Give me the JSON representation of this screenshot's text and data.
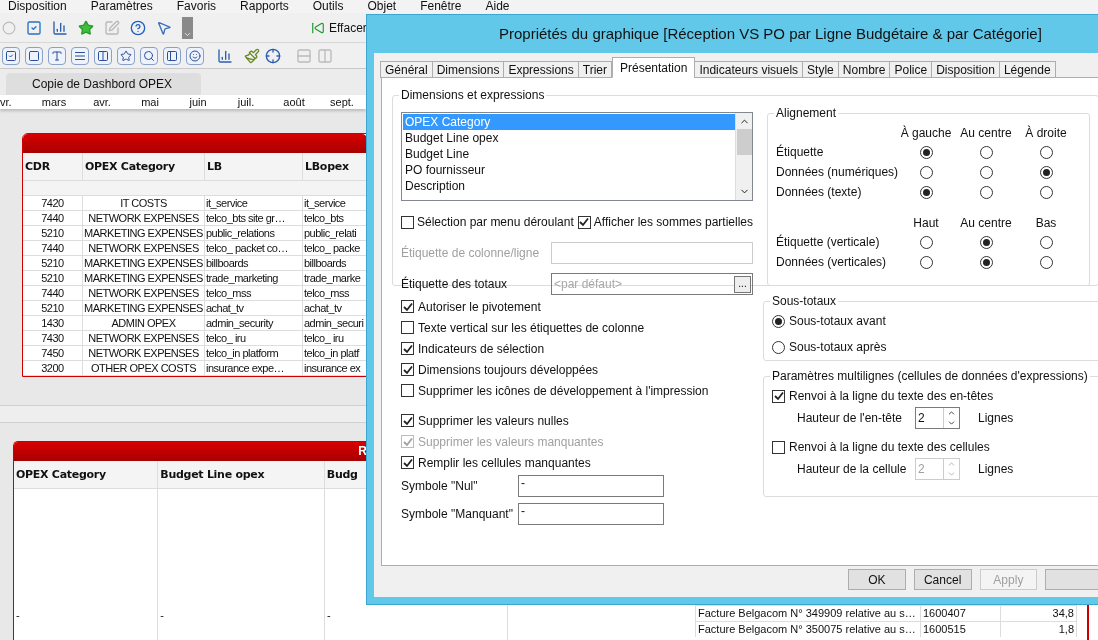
{
  "menu_bar": [
    "Disposition",
    "Paramètres",
    "Favoris",
    "Rapports",
    "Outils",
    "Objet",
    "Fenêtre",
    "Aide"
  ],
  "toolbar": {
    "clear_button": "Effacer"
  },
  "document_tab": "Copie de Dashbord OPEX",
  "timeline": [
    "vr.",
    "mars",
    "avr.",
    "mai",
    "juin",
    "juil.",
    "août",
    "sept."
  ],
  "table_1": {
    "columns": [
      "CDR",
      "OPEX Category",
      "LB",
      "LBopex"
    ],
    "rows": [
      [
        "7420",
        "IT COSTS",
        "it_service",
        "it_service"
      ],
      [
        "7440",
        "NETWORK EXPENSES",
        "telco_bts site gr…",
        "telco_bts"
      ],
      [
        "5210",
        "MARKETING EXPENSES",
        "public_relations",
        "public_relati"
      ],
      [
        "7440",
        "NETWORK EXPENSES",
        "telco_ packet co…",
        "telco_ packe"
      ],
      [
        "5210",
        "MARKETING EXPENSES",
        "billboards",
        "billboards"
      ],
      [
        "5210",
        "MARKETING EXPENSES",
        "trade_marketing",
        "trade_marke"
      ],
      [
        "7440",
        "NETWORK EXPENSES",
        "telco_mss",
        "telco_mss"
      ],
      [
        "5210",
        "MARKETING EXPENSES",
        "achat_tv",
        "achat_tv"
      ],
      [
        "1430",
        "ADMIN OPEX",
        "admin_security",
        "admin_securi"
      ],
      [
        "7430",
        "NETWORK EXPENSES",
        "telco_ iru",
        "telco_ iru"
      ],
      [
        "7450",
        "NETWORK EXPENSES",
        "telco_in platform",
        "telco_in platf"
      ],
      [
        "3200",
        "OTHER OPEX COSTS",
        "insurance expe…",
        "insurance ex"
      ]
    ]
  },
  "table_2": {
    "title": "R",
    "columns": [
      "OPEX Category",
      "Budget Line opex",
      "Budg"
    ],
    "rows": [
      [
        "-",
        "-",
        "-"
      ]
    ]
  },
  "table_3": {
    "rows": [
      [
        "Facture Belgacom N° 349909 relative au s…",
        "1600407",
        "34,8"
      ],
      [
        "Facture Belgacom N° 350075 relative au s…",
        "1600515",
        "1,8"
      ]
    ]
  },
  "dialog": {
    "title": "Propriétés du graphique [Réception VS PO par Ligne Budgétaire & par Catégorie]",
    "tabs": [
      {
        "label": "Général",
        "selected": false
      },
      {
        "label": "Dimensions",
        "selected": false
      },
      {
        "label": "Expressions",
        "selected": false
      },
      {
        "label": "Trier",
        "selected": false
      },
      {
        "label": "Présentation",
        "selected": true
      },
      {
        "label": "Indicateurs visuels",
        "selected": false
      },
      {
        "label": "Style",
        "selected": false
      },
      {
        "label": "Nombre",
        "selected": false
      },
      {
        "label": "Police",
        "selected": false
      },
      {
        "label": "Disposition",
        "selected": false
      },
      {
        "label": "Légende",
        "selected": false
      }
    ],
    "dimensions_group": {
      "label": "Dimensions et expressions",
      "list": [
        {
          "label": "OPEX Category",
          "selected": true
        },
        {
          "label": "Budget Line opex",
          "selected": false
        },
        {
          "label": "Budget Line",
          "selected": false
        },
        {
          "label": "PO fournisseur",
          "selected": false
        },
        {
          "label": "Description",
          "selected": false
        }
      ],
      "dropdown_select": {
        "label": "Sélection par menu déroulant",
        "checked": false
      },
      "partial_sums": {
        "label": "Afficher les sommes partielles",
        "checked": true
      },
      "column_label": {
        "label": "Étiquette de colonne/ligne",
        "disabled": true
      },
      "totals_label": {
        "label": "Étiquette des totaux",
        "placeholder": "<par défaut>",
        "button": "..."
      }
    },
    "alignment": {
      "label": "Alignement",
      "columns": [
        "À gauche",
        "Au centre",
        "À droite"
      ],
      "rows": [
        {
          "label": "Étiquette",
          "options": [
            {
              "selected": true
            },
            {
              "selected": false
            },
            {
              "selected": false
            }
          ]
        },
        {
          "label": "Données (numériques)",
          "options": [
            {
              "selected": false
            },
            {
              "selected": false
            },
            {
              "selected": true
            }
          ]
        },
        {
          "label": "Données (texte)",
          "options": [
            {
              "selected": true
            },
            {
              "selected": false
            },
            {
              "selected": false
            }
          ]
        }
      ],
      "vertical_columns": [
        "Haut",
        "Au centre",
        "Bas"
      ],
      "vertical_rows": [
        {
          "label": "Étiquette (verticale)",
          "options": [
            {
              "selected": false
            },
            {
              "selected": true
            },
            {
              "selected": false
            }
          ]
        },
        {
          "label": "Données (verticales)",
          "options": [
            {
              "selected": false
            },
            {
              "selected": true
            },
            {
              "selected": false
            }
          ]
        }
      ]
    },
    "options_1": [
      {
        "label": "Autoriser le pivotement",
        "checked": true,
        "disabled": false
      },
      {
        "label": "Texte vertical sur les étiquettes de colonne",
        "checked": false,
        "disabled": false
      },
      {
        "label": "Indicateurs de sélection",
        "checked": true,
        "disabled": false
      },
      {
        "label": "Dimensions toujours développées",
        "checked": true,
        "disabled": false
      },
      {
        "label": "Supprimer les icônes de développement à l'impression",
        "checked": false,
        "disabled": false
      }
    ],
    "options_2": [
      {
        "label": "Supprimer les valeurs nulles",
        "checked": true,
        "disabled": false
      },
      {
        "label": "Supprimer les valeurs manquantes",
        "checked": true,
        "disabled": true
      },
      {
        "label": "Remplir les cellules manquantes",
        "checked": true,
        "disabled": false
      }
    ],
    "symbols": [
      {
        "label": "Symbole \"Nul\"",
        "value": "-"
      },
      {
        "label": "Symbole \"Manquant\"",
        "value": "-"
      }
    ],
    "subtotals": {
      "label": "Sous-totaux",
      "options": [
        {
          "label": "Sous-totaux avant",
          "selected": true
        },
        {
          "label": "Sous-totaux après",
          "selected": false
        }
      ]
    },
    "multiline": {
      "label": "Paramètres multilignes (cellules de données d'expressions)",
      "items": [
        {
          "label": "Renvoi à la ligne du texte des en-têtes",
          "checked": true,
          "height_label": "Hauteur de l'en-tête",
          "value": "2",
          "unit": "Lignes",
          "disabled": false
        },
        {
          "label": "Renvoi à la ligne du texte des cellules",
          "checked": false,
          "height_label": "Hauteur de la cellule",
          "value": "2",
          "unit": "Lignes",
          "disabled": true
        }
      ]
    },
    "buttons": [
      {
        "label": "OK",
        "disabled": false
      },
      {
        "label": "Cancel",
        "disabled": false
      },
      {
        "label": "Apply",
        "disabled": true
      }
    ]
  }
}
